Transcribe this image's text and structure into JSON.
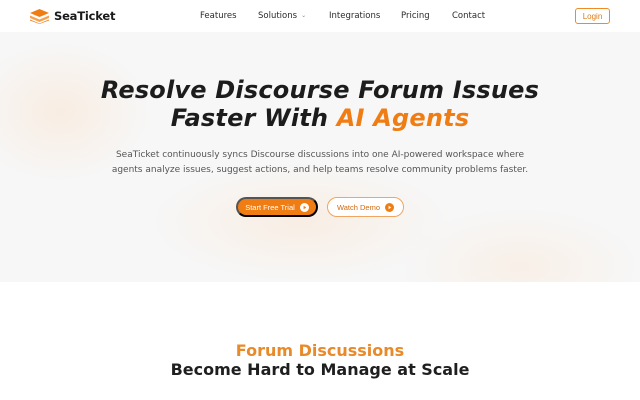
{
  "brand": {
    "name": "SeaTicket",
    "accent_color": "#f07d14"
  },
  "nav": {
    "links": [
      {
        "label": "Features"
      },
      {
        "label": "Solutions",
        "dropdown": true
      },
      {
        "label": "Integrations"
      },
      {
        "label": "Pricing"
      },
      {
        "label": "Contact"
      }
    ],
    "login_label": "Login"
  },
  "hero": {
    "title_line1": "Resolve Discourse Forum Issues",
    "title_line2_prefix": "Faster With ",
    "title_line2_accent": "AI Agents",
    "subtitle_line1": "SeaTicket continuously syncs Discourse discussions into one AI-powered workspace where",
    "subtitle_line2": "agents analyze issues, suggest actions, and help teams resolve community problems faster.",
    "primary_cta": "Start Free Trial",
    "secondary_cta": "Watch Demo"
  },
  "section": {
    "title_accent": "Forum Discussions",
    "title_main": "Become Hard to Manage at Scale"
  }
}
